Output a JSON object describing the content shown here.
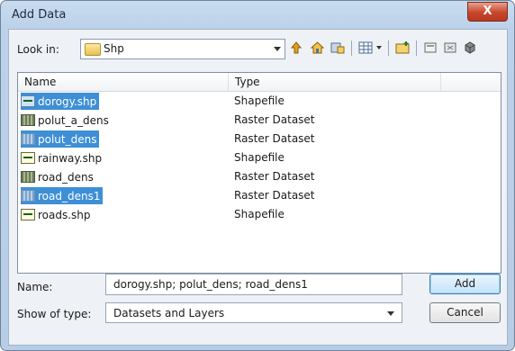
{
  "window": {
    "title": "Add Data",
    "close_glyph": "X"
  },
  "lookin": {
    "label": "Look in:",
    "value": "Shp"
  },
  "toolbar": {
    "icons": [
      "up-one-level-icon",
      "home-icon",
      "connect-folder-icon",
      "view-options-icon",
      "new-folder-icon",
      "catalog-icon",
      "disconnect-icon",
      "gdb-icon"
    ]
  },
  "list": {
    "columns": [
      "Name",
      "Type"
    ],
    "rows": [
      {
        "name": "dorogy.shp",
        "type": "Shapefile",
        "icon": "shapefile-icon",
        "selected": true
      },
      {
        "name": "polut_a_dens",
        "type": "Raster Dataset",
        "icon": "raster-icon",
        "selected": false
      },
      {
        "name": "polut_dens",
        "type": "Raster Dataset",
        "icon": "raster-icon",
        "selected": true
      },
      {
        "name": "rainway.shp",
        "type": "Shapefile",
        "icon": "shapefile-icon",
        "selected": false
      },
      {
        "name": "road_dens",
        "type": "Raster Dataset",
        "icon": "raster-icon",
        "selected": false
      },
      {
        "name": "road_dens1",
        "type": "Raster Dataset",
        "icon": "raster-icon",
        "selected": true
      },
      {
        "name": "roads.shp",
        "type": "Shapefile",
        "icon": "shapefile-icon",
        "selected": false
      }
    ]
  },
  "name_field": {
    "label": "Name:",
    "value": "dorogy.shp; polut_dens; road_dens1"
  },
  "type_field": {
    "label": "Show of type:",
    "value": "Datasets and Layers"
  },
  "buttons": {
    "add": "Add",
    "cancel": "Cancel"
  },
  "colors": {
    "selection": "#3e8fd6",
    "close_button": "#c7452b",
    "frame": "#bcd2ea"
  }
}
